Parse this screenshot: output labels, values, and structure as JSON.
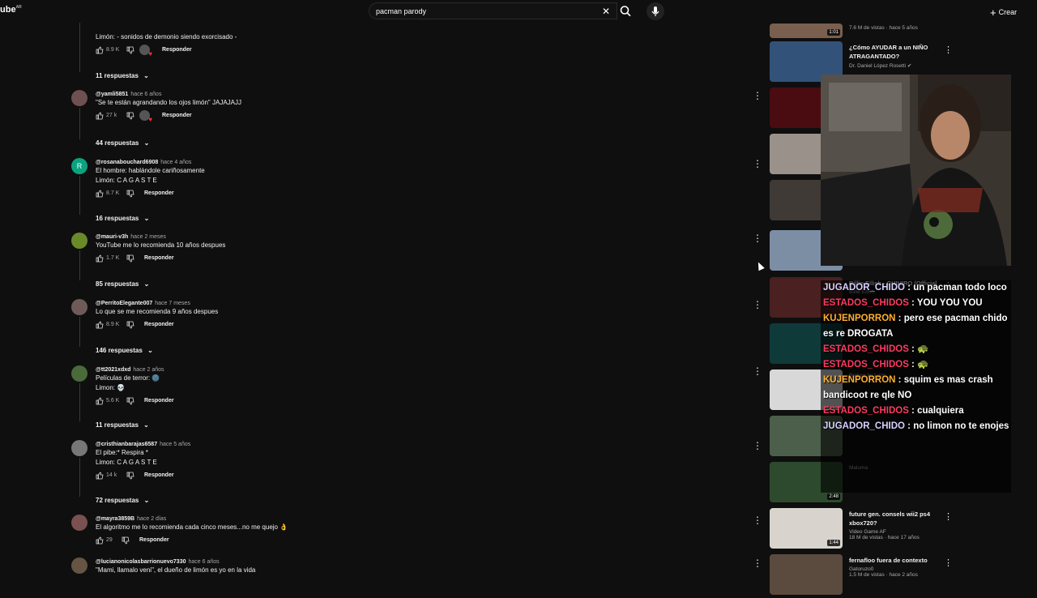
{
  "header": {
    "logo_text": "ube",
    "logo_region": "AR",
    "search_value": "pacman parody",
    "create_label": "Crear",
    "icons": [
      "clear-icon",
      "search-icon",
      "microphone-icon",
      "plus-icon"
    ]
  },
  "comments": [
    {
      "id": "c0",
      "author": "",
      "date": "",
      "text": [
        "Limón: - sonidos de demonio siendo exorcisado -"
      ],
      "likes": "8.9 K",
      "reply_label": "Responder",
      "creator_heart": true,
      "replies_label": "11 respuestas"
    },
    {
      "id": "c1",
      "author": "@yamli5851",
      "date": "hace 6 años",
      "text": [
        "\"Se te están agrandando los ojos limón\" JAJAJAJJ"
      ],
      "likes": "27 k",
      "reply_label": "Responder",
      "creator_heart": true,
      "replies_label": "44 respuestas"
    },
    {
      "id": "c2",
      "author": "@rosanabouchard6908",
      "date": "hace 4 años",
      "avatar_letter": "R",
      "text": [
        "El hombre: hablándole cariñosamente",
        "Limón: C A G A S T E"
      ],
      "likes": "8.7 K",
      "reply_label": "Responder",
      "replies_label": "16 respuestas"
    },
    {
      "id": "c3",
      "author": "@mauri-v3h",
      "date": "hace 2 meses",
      "text": [
        "YouTube me lo recomienda 10 años despues"
      ],
      "likes": "1.7 K",
      "reply_label": "Responder",
      "replies_label": "85 respuestas"
    },
    {
      "id": "c4",
      "author": "@PerritoElegante007",
      "date": "hace 7 meses",
      "text": [
        "Lo que se me recomienda 9 años despues"
      ],
      "likes": "8.9 K",
      "reply_label": "Responder",
      "replies_label": "146 respuestas"
    },
    {
      "id": "c5",
      "author": "@tt2021xdxd",
      "date": "hace 2 años",
      "text": [
        "Películas de terror: 🌚",
        "Limon: 💀"
      ],
      "likes": "5.6 K",
      "reply_label": "Responder",
      "replies_label": "11 respuestas"
    },
    {
      "id": "c6",
      "author": "@cristhianbarajas6587",
      "date": "hace 5 años",
      "text": [
        "El pibe:* Respira *",
        "Limon: C A G A S T E"
      ],
      "likes": "14 k",
      "reply_label": "Responder",
      "replies_label": "72 respuestas"
    },
    {
      "id": "c7",
      "author": "@mayra3859B",
      "date": "hace 2 días",
      "text": [
        "El algoritmo me lo recomienda cada cinco meses...no me quejo 👌"
      ],
      "likes": "29",
      "reply_label": "Responder",
      "replies_label": ""
    },
    {
      "id": "c8",
      "author": "@lucianonicolasbarrionuevo7330",
      "date": "hace 6 años",
      "text": [
        "\"Mami, llamalo veni\", el dueño de limón es yo en la vida"
      ],
      "likes": "",
      "reply_label": "",
      "replies_label": ""
    }
  ],
  "sidebar": [
    {
      "title": "",
      "channel": "",
      "meta": "7.6 M de vistas · hace 5 años",
      "duration": "1:01",
      "thumb_color": "#7a5f4f"
    },
    {
      "title": "¿Cómo AYUDAR a un NIÑO ATRAGANTADO?",
      "channel": "Dr. Daniel López Rosetti ✔",
      "meta": "",
      "duration": "",
      "thumb_color": "#33527a"
    },
    {
      "title": "",
      "channel": "",
      "meta": "",
      "duration": "",
      "thumb_color": "#4a0c10"
    },
    {
      "title": "",
      "channel": "",
      "meta": "",
      "duration": "",
      "thumb_color": "#9a928a"
    },
    {
      "title": "",
      "channel": "",
      "meta": "",
      "duration": "",
      "thumb_color": "#3f3a36"
    },
    {
      "title": "",
      "channel": "",
      "meta": "",
      "duration": "",
      "thumb_color": "#7c8ea4"
    },
    {
      "title": "Billie Eilish - CHIHIRO (Official",
      "channel": "Billie Eilish",
      "meta": "",
      "duration": "",
      "thumb_color": "#4a2020"
    },
    {
      "title": "",
      "channel": "",
      "meta": "",
      "duration": "",
      "thumb_color": "#0f3a3a"
    },
    {
      "title": "",
      "channel": "Broken by Luigi",
      "meta": "",
      "duration": "",
      "thumb_color": "#d8d8d8"
    },
    {
      "title": "",
      "channel": "",
      "meta": "",
      "duration": "",
      "thumb_color": "#4c5f4b"
    },
    {
      "title": "",
      "channel": "Maluma",
      "meta": "",
      "duration": "2:48",
      "thumb_color": "#2e4a2e"
    },
    {
      "title": "future gen. consels wii2 ps4 xbox720?",
      "channel": "Video Game AF",
      "meta": "18 M de vistas · hace 17 años",
      "duration": "1:44",
      "thumb_color": "#d8d4cd"
    },
    {
      "title": "fernafloo fuera de contexto",
      "channel": "Gatoruzo0",
      "meta": "1.5 M de vistas · hace 2 años",
      "duration": "",
      "thumb_color": "#5b4a3e"
    }
  ],
  "chat": [
    {
      "user": "JUGADOR_CHIDO",
      "color": "#d9d0ff",
      "message": " : un pacman todo loco"
    },
    {
      "user": "ESTADOS_CHIDOS",
      "color": "#ff3b5f",
      "message": " : YOU YOU YOU"
    },
    {
      "user": "KUJENPORRON",
      "color": "#ffb02e",
      "message": " : pero ese pacman chido es re DROGATA"
    },
    {
      "user": "ESTADOS_CHIDOS",
      "color": "#ff3b5f",
      "message": " : 🐢"
    },
    {
      "user": "ESTADOS_CHIDOS",
      "color": "#ff3b5f",
      "message": " : 🐢"
    },
    {
      "user": "KUJENPORRON",
      "color": "#ffb02e",
      "message": " : squim es mas crash bandicoot re qle NO"
    },
    {
      "user": "ESTADOS_CHIDOS",
      "color": "#ff3b5f",
      "message": " : cualquiera"
    },
    {
      "user": "JUGADOR_CHIDO",
      "color": "#d9d0ff",
      "message": " : no limon no te enojes"
    }
  ]
}
